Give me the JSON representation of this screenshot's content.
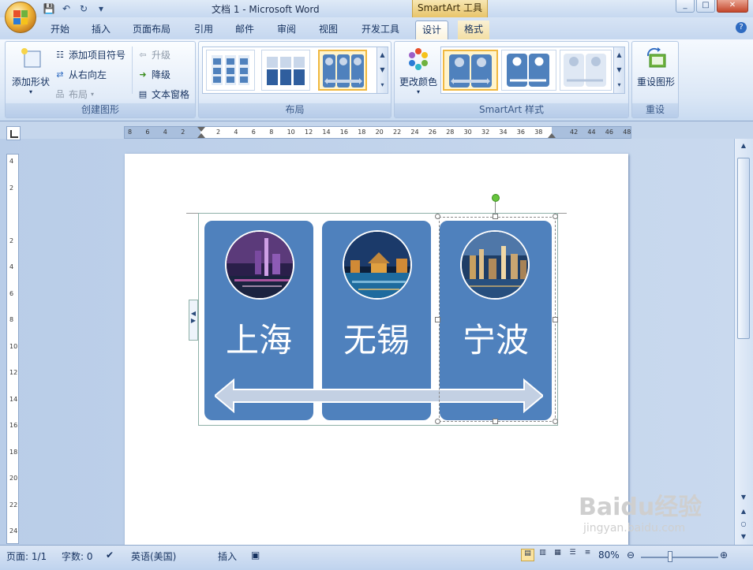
{
  "window": {
    "title": "文档 1 - Microsoft Word",
    "contextual_title": "SmartArt 工具",
    "min": "_",
    "max": "□",
    "close": "✕"
  },
  "tabs": [
    "开始",
    "插入",
    "页面布局",
    "引用",
    "邮件",
    "审阅",
    "视图",
    "开发工具",
    "设计",
    "格式"
  ],
  "active_tab": "设计",
  "ribbon": {
    "create": {
      "add_shape": "添加形状",
      "add_bullet": "添加项目符号",
      "rtl": "从右向左",
      "layout": "布局",
      "promote": "升级",
      "demote": "降级",
      "text_pane": "文本窗格",
      "label": "创建图形"
    },
    "layouts_label": "布局",
    "styles": {
      "change_colors": "更改颜色",
      "label": "SmartArt 样式"
    },
    "reset": {
      "reset_graphic": "重设图形",
      "label": "重设"
    }
  },
  "ruler": {
    "h_ticks": [
      "8",
      "6",
      "4",
      "2",
      "",
      "2",
      "4",
      "6",
      "8",
      "10",
      "12",
      "14",
      "16",
      "18",
      "20",
      "22",
      "24",
      "26",
      "28",
      "30",
      "32",
      "34",
      "36",
      "38",
      "",
      "42",
      "44",
      "46",
      "48"
    ],
    "v_ticks": [
      "4",
      "2",
      "",
      "2",
      "4",
      "6",
      "8",
      "10",
      "12",
      "14",
      "16",
      "18",
      "20",
      "22",
      "24"
    ]
  },
  "smartart": {
    "items": [
      {
        "label": "上海"
      },
      {
        "label": "无锡"
      },
      {
        "label": "宁波"
      }
    ],
    "fill_color": "#4f81bd"
  },
  "status": {
    "page": "页面: 1/1",
    "words": "字数: 0",
    "language": "英语(美国)",
    "mode": "插入",
    "zoom": "80%"
  },
  "watermark": {
    "brand": "Baidu经验",
    "url": "jingyan.baidu.com"
  }
}
